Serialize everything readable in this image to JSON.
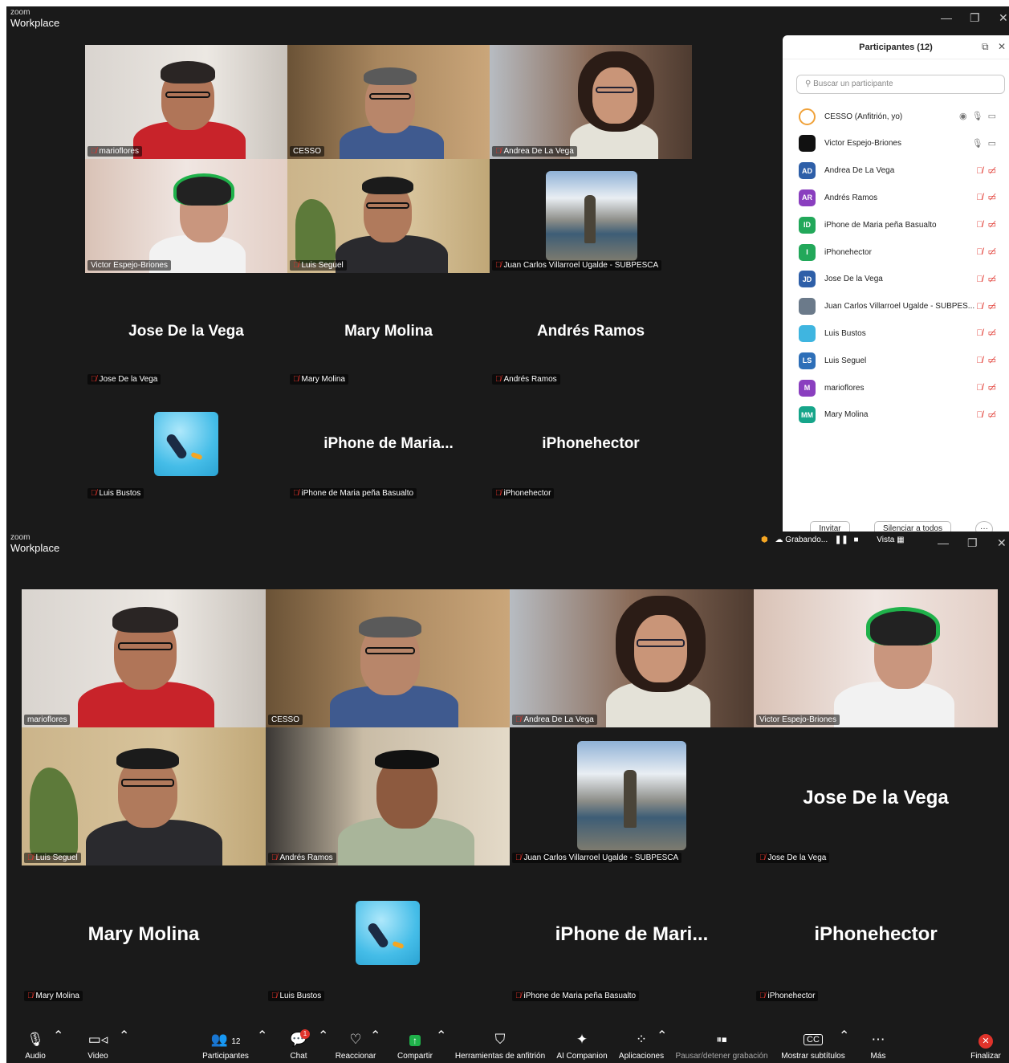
{
  "app": {
    "brand_small": "zoom",
    "brand_large": "Workplace"
  },
  "top": {
    "tiles": [
      {
        "name": "marioflores",
        "muted": true
      },
      {
        "name": "CESSO",
        "muted": false
      },
      {
        "name": "Andrea De La Vega",
        "muted": true
      },
      {
        "name": "Victor Espejo-Briones",
        "muted": false
      },
      {
        "name": "Luis Seguel",
        "muted": true
      },
      {
        "name": "Juan Carlos Villarroel Ugalde - SUBPESCA",
        "muted": true
      }
    ],
    "name_tiles": [
      {
        "display": "Jose De la Vega",
        "tag": "Jose De la Vega"
      },
      {
        "display": "Mary Molina",
        "tag": "Mary Molina"
      },
      {
        "display": "Andrés Ramos",
        "tag": "Andrés Ramos"
      },
      {
        "display": "",
        "tag": "Luis Bustos"
      },
      {
        "display": "iPhone de Maria...",
        "tag": "iPhone de Maria peña Basualto"
      },
      {
        "display": "iPhonehector",
        "tag": "iPhonehector"
      }
    ]
  },
  "panel": {
    "title": "Participantes (12)",
    "search_placeholder": "Buscar un participante",
    "participants": [
      {
        "initials": "",
        "name": "CESSO (Anfitrión, yo)",
        "color": "#ffffff"
      },
      {
        "initials": "",
        "name": "Victor Espejo-Briones",
        "color": "#111111"
      },
      {
        "initials": "AD",
        "name": "Andrea De La Vega",
        "color": "#2e5fa8"
      },
      {
        "initials": "AR",
        "name": "Andrés Ramos",
        "color": "#8a3fbf"
      },
      {
        "initials": "ID",
        "name": "iPhone de Maria peña Basualto",
        "color": "#22a85a"
      },
      {
        "initials": "I",
        "name": "iPhonehector",
        "color": "#22a85a"
      },
      {
        "initials": "JD",
        "name": "Jose De la Vega",
        "color": "#2e5fa8"
      },
      {
        "initials": "",
        "name": "Juan Carlos Villarroel Ugalde - SUBPES...",
        "color": "#6b7a8a"
      },
      {
        "initials": "",
        "name": "Luis Bustos",
        "color": "#3fb5e0"
      },
      {
        "initials": "LS",
        "name": "Luis Seguel",
        "color": "#2e6fb8"
      },
      {
        "initials": "M",
        "name": "marioflores",
        "color": "#8a3fbf"
      },
      {
        "initials": "MM",
        "name": "Mary Molina",
        "color": "#16a58a"
      }
    ],
    "invite": "Invitar",
    "mute_all": "Silenciar a todos",
    "more": "···"
  },
  "bottom": {
    "recording": "Grabando...",
    "view": "Vista",
    "tiles": [
      {
        "name": "marioflores",
        "muted": false
      },
      {
        "name": "CESSO",
        "muted": false
      },
      {
        "name": "Andrea De La Vega",
        "muted": true
      },
      {
        "name": "Victor Espejo-Briones",
        "muted": false
      },
      {
        "name": "Luis Seguel",
        "muted": true
      },
      {
        "name": "Andrés Ramos",
        "muted": true
      },
      {
        "name": "Juan Carlos Villarroel Ugalde - SUBPESCA",
        "muted": true
      },
      {
        "name": "Jose De la Vega",
        "muted": true
      }
    ],
    "big_jose": "Jose De la Vega",
    "name_tiles": [
      {
        "display": "Mary Molina",
        "tag": "Mary Molina"
      },
      {
        "display": "",
        "tag": "Luis Bustos"
      },
      {
        "display": "iPhone de Mari...",
        "tag": "iPhone de Maria peña Basualto"
      },
      {
        "display": "iPhonehector",
        "tag": "iPhonehector"
      }
    ]
  },
  "toolbar": {
    "audio": "Audio",
    "video": "Video",
    "participants": "Participantes",
    "participants_count": "12",
    "chat": "Chat",
    "chat_badge": "1",
    "react": "Reaccionar",
    "share": "Compartir",
    "host_tools": "Herramientas de anfitrión",
    "ai": "AI Companion",
    "apps": "Aplicaciones",
    "pause_rec": "Pausar/detener grabación",
    "captions": "Mostrar subtítulos",
    "more": "Más",
    "end": "Finalizar"
  },
  "colors": {
    "accent_green": "#2fcc66",
    "muted_red": "#e0332b",
    "bg": "#1a1a1a",
    "end_red": "#e0332b"
  }
}
